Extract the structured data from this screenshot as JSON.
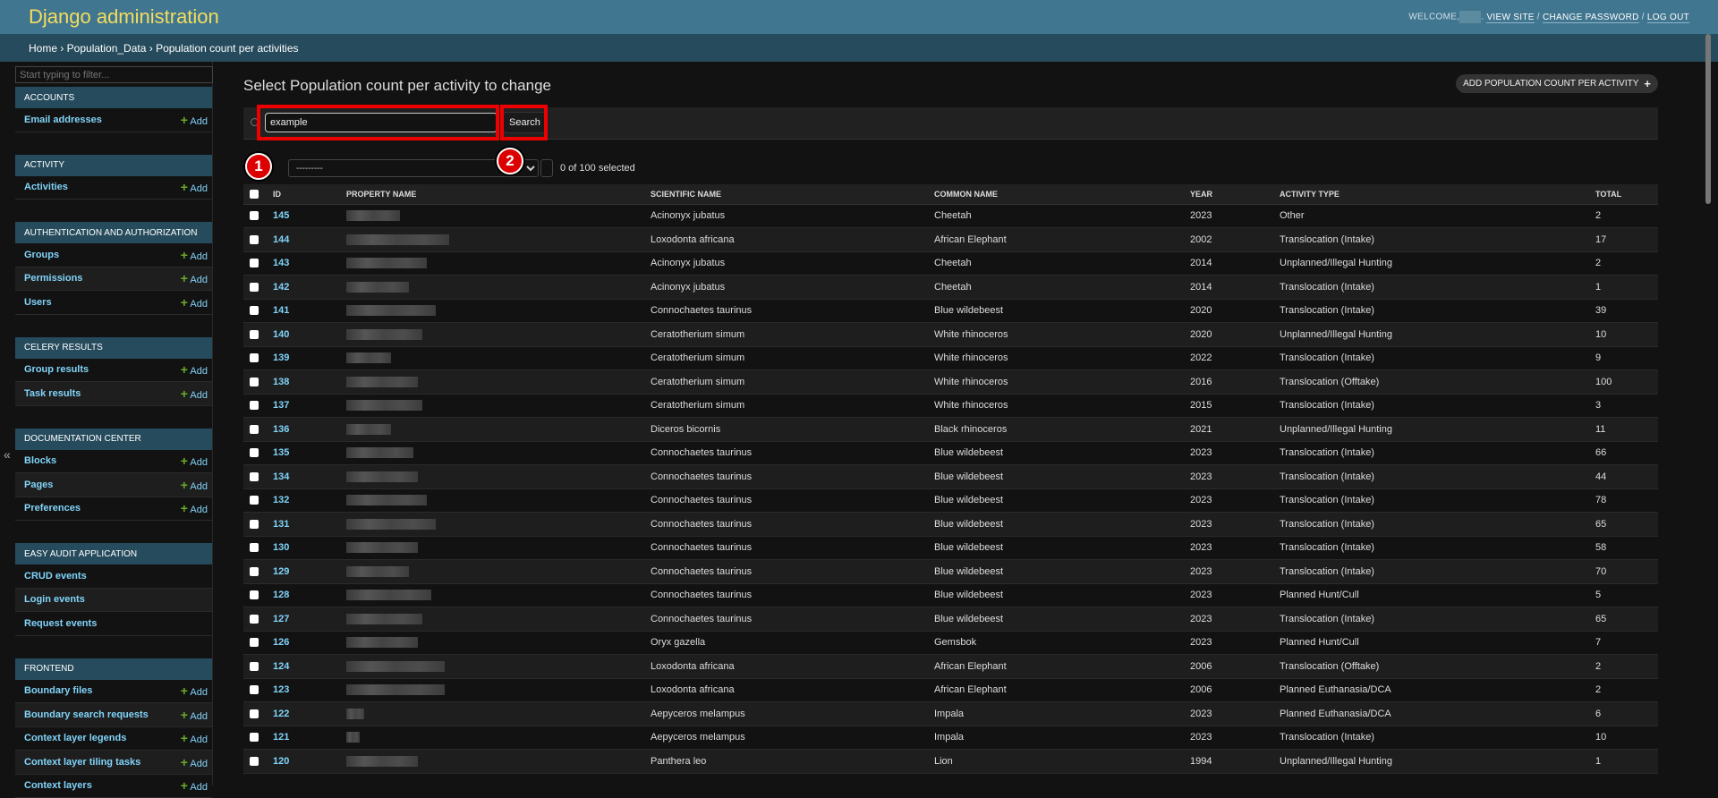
{
  "header": {
    "title": "Django administration",
    "welcome": "WELCOME,",
    "view_site": "VIEW SITE",
    "change_password": "CHANGE PASSWORD",
    "log_out": "LOG OUT"
  },
  "breadcrumbs": "Home › Population_Data › Population count per activities",
  "sidebar": {
    "filter_placeholder": "Start typing to filter...",
    "add_label": "Add",
    "sections": [
      {
        "title": "ACCOUNTS",
        "items": [
          {
            "label": "Email addresses",
            "add": true
          }
        ]
      },
      {
        "title": "ACTIVITY",
        "items": [
          {
            "label": "Activities",
            "add": true
          }
        ]
      },
      {
        "title": "AUTHENTICATION AND AUTHORIZATION",
        "items": [
          {
            "label": "Groups",
            "add": true
          },
          {
            "label": "Permissions",
            "add": true
          },
          {
            "label": "Users",
            "add": true
          }
        ]
      },
      {
        "title": "CELERY RESULTS",
        "items": [
          {
            "label": "Group results",
            "add": true
          },
          {
            "label": "Task results",
            "add": true
          }
        ]
      },
      {
        "title": "DOCUMENTATION CENTER",
        "items": [
          {
            "label": "Blocks",
            "add": true
          },
          {
            "label": "Pages",
            "add": true
          },
          {
            "label": "Preferences",
            "add": true
          }
        ]
      },
      {
        "title": "EASY AUDIT APPLICATION",
        "items": [
          {
            "label": "CRUD events",
            "add": false
          },
          {
            "label": "Login events",
            "add": false
          },
          {
            "label": "Request events",
            "add": false
          }
        ]
      },
      {
        "title": "FRONTEND",
        "items": [
          {
            "label": "Boundary files",
            "add": true
          },
          {
            "label": "Boundary search requests",
            "add": true
          },
          {
            "label": "Context layer legends",
            "add": true
          },
          {
            "label": "Context layer tiling tasks",
            "add": true
          },
          {
            "label": "Context layers",
            "add": true
          }
        ]
      }
    ]
  },
  "main": {
    "title": "Select Population count per activity to change",
    "add_button": "ADD POPULATION COUNT PER ACTIVITY",
    "search_value": "example",
    "search_button": "Search",
    "action_value": "---------",
    "counter": "0 of 100 selected",
    "columns": [
      "ID",
      "PROPERTY NAME",
      "SCIENTIFIC NAME",
      "COMMON NAME",
      "YEAR",
      "ACTIVITY TYPE",
      "TOTAL"
    ],
    "rows": [
      [
        "145",
        "Acinonyx jubatus",
        "Cheetah",
        "2023",
        "Other",
        "2"
      ],
      [
        "144",
        "Loxodonta africana",
        "African Elephant",
        "2002",
        "Translocation (Intake)",
        "17"
      ],
      [
        "143",
        "Acinonyx jubatus",
        "Cheetah",
        "2014",
        "Unplanned/Illegal Hunting",
        "2"
      ],
      [
        "142",
        "Acinonyx jubatus",
        "Cheetah",
        "2014",
        "Translocation (Intake)",
        "1"
      ],
      [
        "141",
        "Connochaetes taurinus",
        "Blue wildebeest",
        "2020",
        "Translocation (Intake)",
        "39"
      ],
      [
        "140",
        "Ceratotherium simum",
        "White rhinoceros",
        "2020",
        "Unplanned/Illegal Hunting",
        "10"
      ],
      [
        "139",
        "Ceratotherium simum",
        "White rhinoceros",
        "2022",
        "Translocation (Intake)",
        "9"
      ],
      [
        "138",
        "Ceratotherium simum",
        "White rhinoceros",
        "2016",
        "Translocation (Offtake)",
        "100"
      ],
      [
        "137",
        "Ceratotherium simum",
        "White rhinoceros",
        "2015",
        "Translocation (Intake)",
        "3"
      ],
      [
        "136",
        "Diceros bicornis",
        "Black rhinoceros",
        "2021",
        "Unplanned/Illegal Hunting",
        "11"
      ],
      [
        "135",
        "Connochaetes taurinus",
        "Blue wildebeest",
        "2023",
        "Translocation (Intake)",
        "66"
      ],
      [
        "134",
        "Connochaetes taurinus",
        "Blue wildebeest",
        "2023",
        "Translocation (Intake)",
        "44"
      ],
      [
        "132",
        "Connochaetes taurinus",
        "Blue wildebeest",
        "2023",
        "Translocation (Intake)",
        "78"
      ],
      [
        "131",
        "Connochaetes taurinus",
        "Blue wildebeest",
        "2023",
        "Translocation (Intake)",
        "65"
      ],
      [
        "130",
        "Connochaetes taurinus",
        "Blue wildebeest",
        "2023",
        "Translocation (Intake)",
        "58"
      ],
      [
        "129",
        "Connochaetes taurinus",
        "Blue wildebeest",
        "2023",
        "Translocation (Intake)",
        "70"
      ],
      [
        "128",
        "Connochaetes taurinus",
        "Blue wildebeest",
        "2023",
        "Planned Hunt/Cull",
        "5"
      ],
      [
        "127",
        "Connochaetes taurinus",
        "Blue wildebeest",
        "2023",
        "Translocation (Intake)",
        "65"
      ],
      [
        "126",
        "Oryx gazella",
        "Gemsbok",
        "2023",
        "Planned Hunt/Cull",
        "7"
      ],
      [
        "124",
        "Loxodonta africana",
        "African Elephant",
        "2006",
        "Translocation (Offtake)",
        "2"
      ],
      [
        "123",
        "Loxodonta africana",
        "African Elephant",
        "2006",
        "Planned Euthanasia/DCA",
        "2"
      ],
      [
        "122",
        "Aepyceros melampus",
        "Impala",
        "2023",
        "Planned Euthanasia/DCA",
        "6"
      ],
      [
        "121",
        "Aepyceros melampus",
        "Impala",
        "2023",
        "Translocation (Intake)",
        "10"
      ],
      [
        "120",
        "Panthera leo",
        "Lion",
        "1994",
        "Unplanned/Illegal Hunting",
        "1"
      ]
    ]
  },
  "annotations": {
    "marker1": "1",
    "marker2": "2",
    "color": "#e00000"
  }
}
